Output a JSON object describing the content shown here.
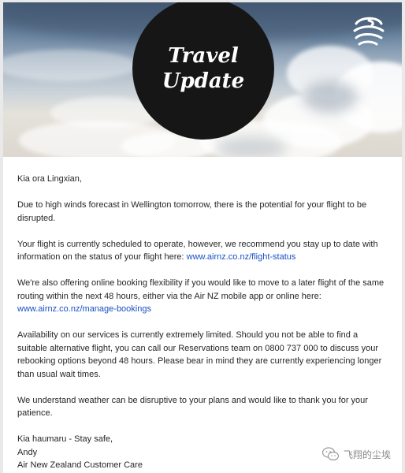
{
  "banner": {
    "heading_line1": "Travel",
    "heading_line2": "Update",
    "logo_icon": "koru-icon"
  },
  "email": {
    "greeting": "Kia ora Lingxian,",
    "p1": "Due to high winds forecast in Wellington tomorrow, there is the potential for your flight to be disrupted.",
    "p2_text": "Your flight is currently scheduled to operate, however, we recommend you stay up to date with information on the status of your flight here: ",
    "p2_link": "www.airnz.co.nz/flight-status",
    "p3_text": "We're also offering online booking flexibility if you would like to move to a later flight of the same routing within the next 48 hours, either via the Air NZ mobile app or online here: ",
    "p3_link": "www.airnz.co.nz/manage-bookings",
    "p4": "Availability on our services is currently extremely limited. Should you not be able to find a suitable alternative flight, you can call our Reservations team on 0800 737 000 to discuss your rebooking options beyond 48 hours. Please bear in mind they are currently experiencing longer than usual wait times.",
    "p5": "We understand weather can be disruptive to your plans and would like to thank you for your patience.",
    "signoff": "Kia haumaru - Stay safe,",
    "sender_name": "Andy",
    "sender_team": "Air New Zealand Customer Care"
  },
  "watermark": {
    "text": "飞翔的尘埃",
    "icon": "wechat-icon"
  },
  "colors": {
    "link": "#1a4fc4",
    "circle": "#161616",
    "text": "#262626"
  }
}
